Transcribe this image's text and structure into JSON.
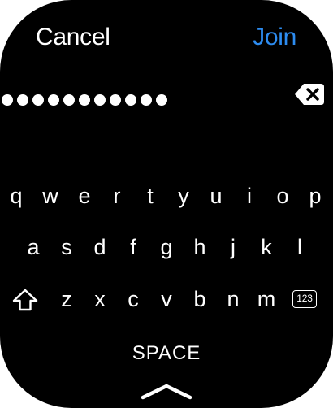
{
  "colors": {
    "accent": "#2d8cf0",
    "text": "#ffffff",
    "background": "#000000"
  },
  "header": {
    "cancel_label": "Cancel",
    "join_label": "Join"
  },
  "password": {
    "masked_char_count": 11
  },
  "icons": {
    "delete": "delete-backward-icon",
    "shift": "shift-arrow-icon",
    "dismiss": "chevron-up-icon"
  },
  "keyboard": {
    "rows": [
      [
        "q",
        "w",
        "e",
        "r",
        "t",
        "y",
        "u",
        "i",
        "o",
        "p"
      ],
      [
        "a",
        "s",
        "d",
        "f",
        "g",
        "h",
        "j",
        "k",
        "l"
      ],
      [
        "z",
        "x",
        "c",
        "v",
        "b",
        "n",
        "m"
      ]
    ],
    "numbers_label": "123",
    "space_label": "SPACE"
  }
}
